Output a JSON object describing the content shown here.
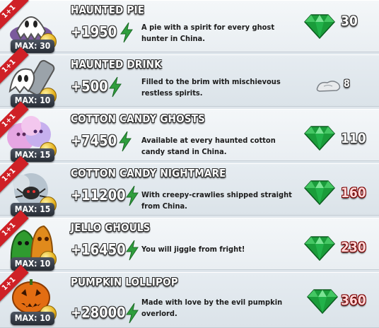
{
  "colors": {
    "ribbon": "#cf2026",
    "bolt": "#2f9e3d",
    "gem": "#1a9c3a",
    "premium_price": "#ffd8d8"
  },
  "items": [
    {
      "badge": "1+1",
      "name": "HAUNTED PIE",
      "score": "+1950",
      "description": "A pie with a spirit for every ghost hunter in China.",
      "max": "MAX: 30",
      "currency": "gem-icon",
      "price": "30",
      "premium": false
    },
    {
      "badge": "1+1",
      "name": "HAUNTED DRINK",
      "score": "+500",
      "description": "Filled to the brim with mischievous restless spirits.",
      "max": "MAX: 10",
      "currency": "silver-icon",
      "price": "8",
      "premium": false
    },
    {
      "badge": "1+1",
      "name": "COTTON CANDY GHOSTS",
      "score": "+7450",
      "description": "Available at every haunted cotton candy stand in China.",
      "max": "MAX: 15",
      "currency": "gem-icon",
      "price": "110",
      "premium": false
    },
    {
      "badge": "1+1",
      "name": "COTTON CANDY NIGHTMARE",
      "score": "+11200",
      "description": "With creepy-crawlies shipped straight from China.",
      "max": "MAX: 15",
      "currency": "gem-icon",
      "price": "160",
      "premium": true
    },
    {
      "badge": "1+1",
      "name": "JELLO GHOULS",
      "score": "+16450",
      "description": "You will jiggle from fright!",
      "max": "MAX: 10",
      "currency": "gem-icon",
      "price": "230",
      "premium": true
    },
    {
      "badge": "1+1",
      "name": "PUMPKIN LOLLIPOP",
      "score": "+28000",
      "description": "Made with love by the evil pumpkin overlord.",
      "max": "MAX: 10",
      "currency": "gem-icon",
      "price": "360",
      "premium": true
    }
  ]
}
